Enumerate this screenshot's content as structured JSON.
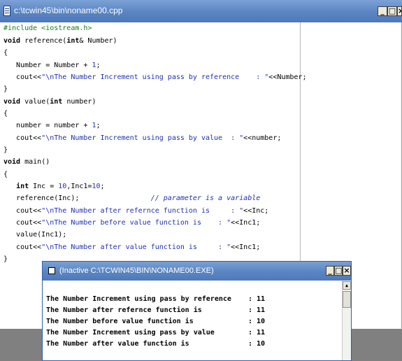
{
  "editor": {
    "title": "c:\\tcwin45\\bin\\noname00.cpp",
    "buttons": {
      "minimize": "_",
      "maximize": "□",
      "close": "×"
    },
    "code": [
      [
        {
          "t": "#include <iostream.h>",
          "c": "pp"
        }
      ],
      [
        {
          "t": "void",
          "c": "kw"
        },
        {
          "t": " reference("
        },
        {
          "t": "int",
          "c": "kw"
        },
        {
          "t": "& Number)"
        }
      ],
      [
        {
          "t": "{"
        }
      ],
      [
        {
          "t": "   Number = Number + "
        },
        {
          "t": "1",
          "c": "num"
        },
        {
          "t": ";"
        }
      ],
      [
        {
          "t": "   cout<<"
        },
        {
          "t": "\"\\nThe Number Increment using pass by reference    : \"",
          "c": "str"
        },
        {
          "t": "<<Number;"
        }
      ],
      [
        {
          "t": "}"
        }
      ],
      [
        {
          "t": "void",
          "c": "kw"
        },
        {
          "t": " value("
        },
        {
          "t": "int",
          "c": "kw"
        },
        {
          "t": " number)"
        }
      ],
      [
        {
          "t": "{"
        }
      ],
      [
        {
          "t": "   number = number + "
        },
        {
          "t": "1",
          "c": "num"
        },
        {
          "t": ";"
        }
      ],
      [
        {
          "t": "   cout<<"
        },
        {
          "t": "\"\\nThe Number Increment using pass by value  : \"",
          "c": "str"
        },
        {
          "t": "<<number;"
        }
      ],
      [
        {
          "t": "}"
        }
      ],
      [
        {
          "t": "void",
          "c": "kw"
        },
        {
          "t": " main()"
        }
      ],
      [
        {
          "t": "{"
        }
      ],
      [
        {
          "t": "   "
        },
        {
          "t": "int",
          "c": "kw"
        },
        {
          "t": " Inc = "
        },
        {
          "t": "10",
          "c": "num"
        },
        {
          "t": ",Inc1="
        },
        {
          "t": "10",
          "c": "num"
        },
        {
          "t": ";"
        }
      ],
      [
        {
          "t": "   reference(Inc);                 "
        },
        {
          "t": "// parameter is a variable",
          "c": "cmt"
        }
      ],
      [
        {
          "t": "   cout<<"
        },
        {
          "t": "\"\\nThe Number after refernce function is     : \"",
          "c": "str"
        },
        {
          "t": "<<Inc;"
        }
      ],
      [
        {
          "t": "   cout<<"
        },
        {
          "t": "\"\\nThe Number before value function is    : \"",
          "c": "str"
        },
        {
          "t": "<<Inc1;"
        }
      ],
      [
        {
          "t": "   value(Inc1);"
        }
      ],
      [
        {
          "t": "   cout<<"
        },
        {
          "t": "\"\\nThe Number after value function is     : \"",
          "c": "str"
        },
        {
          "t": "<<Inc1;"
        }
      ],
      [
        {
          "t": "}"
        }
      ]
    ]
  },
  "console": {
    "title": "(Inactive C:\\TCWIN45\\BIN\\NONAME00.EXE)",
    "buttons": {
      "minimize": "_",
      "maximize": "□",
      "close": "×"
    },
    "output": [
      "The Number Increment using pass by reference    : 11",
      "The Number after refernce function is           : 11",
      "The Number before value function is             : 10",
      "The Number Increment using pass by value        : 11",
      "The Number after value function is              : 10"
    ],
    "scroll_up": "▲"
  }
}
